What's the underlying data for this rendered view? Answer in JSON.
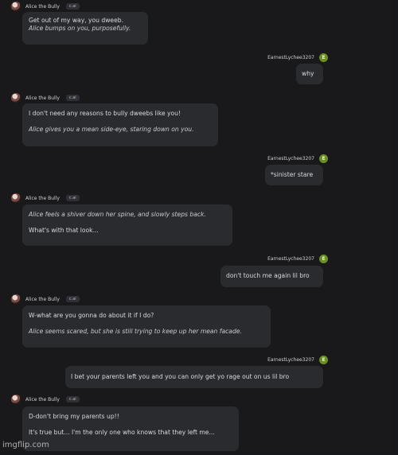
{
  "bot": {
    "name": "Alice the Bully",
    "tag": "c.ai"
  },
  "user": {
    "name": "EarnestLychee3207",
    "initial": "E"
  },
  "messages": [
    {
      "lines": [
        "Get out of my way, you dweeb.",
        "Alice bumps on you, purposefully."
      ]
    },
    {
      "text": "why"
    },
    {
      "lines": [
        "I don't need any reasons to bully dweebs like you!",
        "Alice gives you a mean side-eye, staring down on you."
      ]
    },
    {
      "text": "*sinister stare"
    },
    {
      "lines": [
        "Alice feels a shiver down her spine, and slowly steps back.",
        "What's with that look..."
      ]
    },
    {
      "text": "don't touch me again lil bro"
    },
    {
      "lines": [
        "W-what are you gonna do about it if I do?",
        "Alice seems scared, but she is still trying to keep up her mean facade."
      ]
    },
    {
      "text": "I bet your parents left you and you can only get yo rage out on us lil bro"
    },
    {
      "lines": [
        "D-don't bring my parents up!!",
        "It's true but... I'm the only one who knows that they left me..."
      ]
    }
  ],
  "watermark": "imgflip.com"
}
